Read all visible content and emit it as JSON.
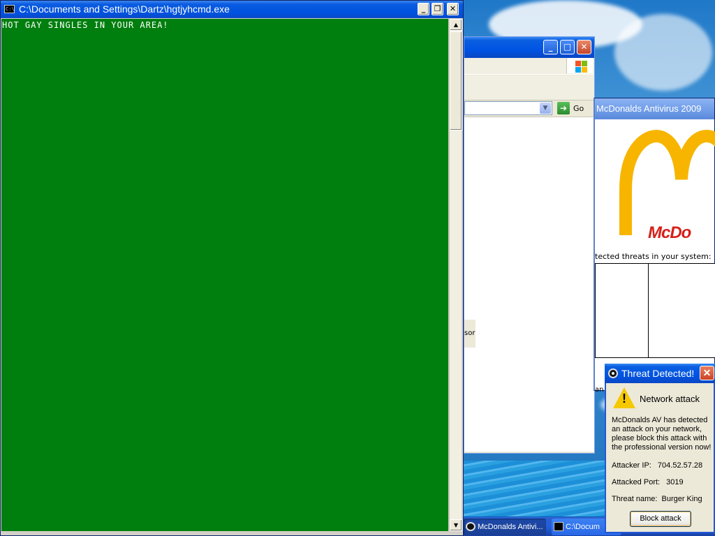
{
  "console": {
    "title": "C:\\Documents and Settings\\Dartz\\hgtjyhcmd.exe",
    "icon_text": "C:\\",
    "output": "HOT GAY SINGLES IN YOUR AREA!",
    "screen_color": "#007f0e"
  },
  "browser": {
    "go_label": "Go",
    "side_fragment": "sor"
  },
  "antivirus": {
    "title": "McDonalds Antivirus 2009",
    "logo_text": "McDo",
    "threats_label": "tected threats in your system:",
    "partial_text": "an",
    "brand_colors": {
      "arches": "#f7b500",
      "logo_red": "#d6201a"
    }
  },
  "popup": {
    "title": "Threat Detected!",
    "heading": "Network attack",
    "message": "McDonalds AV has detected an attack on your network, please block this attack with the professional version now!",
    "attacker_ip_label": "Attacker IP:",
    "attacker_ip": "704.52.57.28",
    "attacked_port_label": "Attacked Port:",
    "attacked_port": "3019",
    "threat_name_label": "Threat name:",
    "threat_name": "Burger King",
    "block_button": "Block attack"
  },
  "taskbar": {
    "items": [
      {
        "label": "McDonalds Antivi...",
        "active": true
      },
      {
        "label": "C:\\Docum",
        "active": false
      }
    ]
  }
}
